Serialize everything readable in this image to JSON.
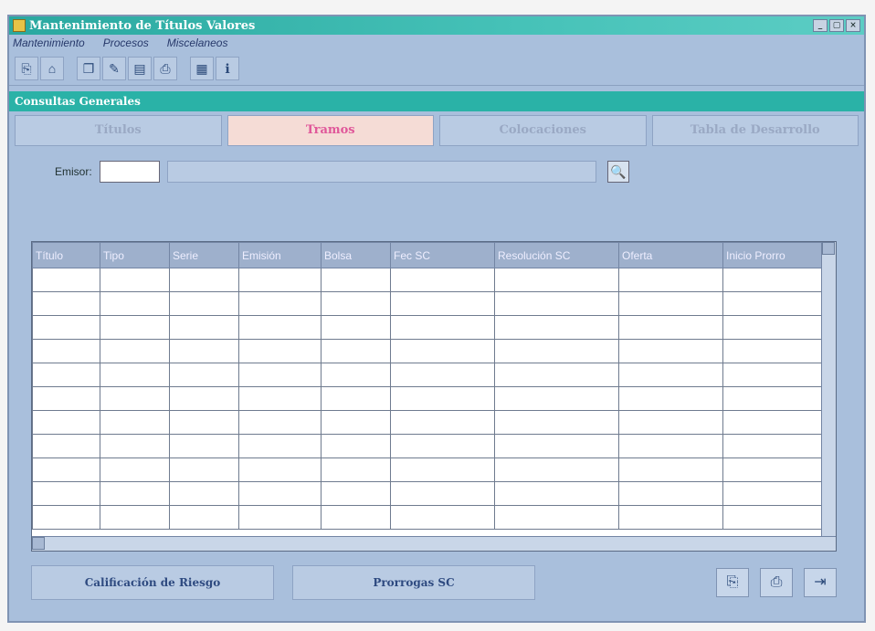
{
  "window": {
    "title": "Mantenimiento de Títulos Valores",
    "controls": [
      "_",
      "▢",
      "×"
    ]
  },
  "menu": [
    "Mantenimiento",
    "Procesos",
    "Miscelaneos"
  ],
  "toolbar": {
    "buttons": [
      {
        "name": "new-icon",
        "glyph": "⎘"
      },
      {
        "name": "open-icon",
        "glyph": "⌂"
      },
      {
        "name": "copy-icon",
        "glyph": "❐"
      },
      {
        "name": "edit-icon",
        "glyph": "✎"
      },
      {
        "name": "save-icon",
        "glyph": "▤"
      },
      {
        "name": "print-icon",
        "glyph": "⎙"
      },
      {
        "name": "chart-icon",
        "glyph": "▦"
      },
      {
        "name": "info-icon",
        "glyph": "ℹ"
      }
    ]
  },
  "panel": {
    "title": "Consultas Generales"
  },
  "tabs": [
    "Títulos",
    "Tramos",
    "Colocaciones",
    "Tabla de Desarrollo"
  ],
  "active_tab": 1,
  "filter": {
    "label": "Emisor:",
    "code": "",
    "name": ""
  },
  "grid": {
    "columns": [
      "Título",
      "Tipo",
      "Serie",
      "Emisión",
      "Bolsa",
      "Fec SC",
      "Resolución SC",
      "Oferta",
      "Inicio Prorro"
    ],
    "row_count": 11
  },
  "buttons": {
    "riesgo": "Calificación de Riesgo",
    "prorrogas": "Prorrogas SC"
  },
  "action_icons": [
    {
      "name": "view-icon",
      "glyph": "⎘"
    },
    {
      "name": "printer-icon",
      "glyph": "⎙"
    },
    {
      "name": "exit-icon",
      "glyph": "⇥"
    }
  ]
}
